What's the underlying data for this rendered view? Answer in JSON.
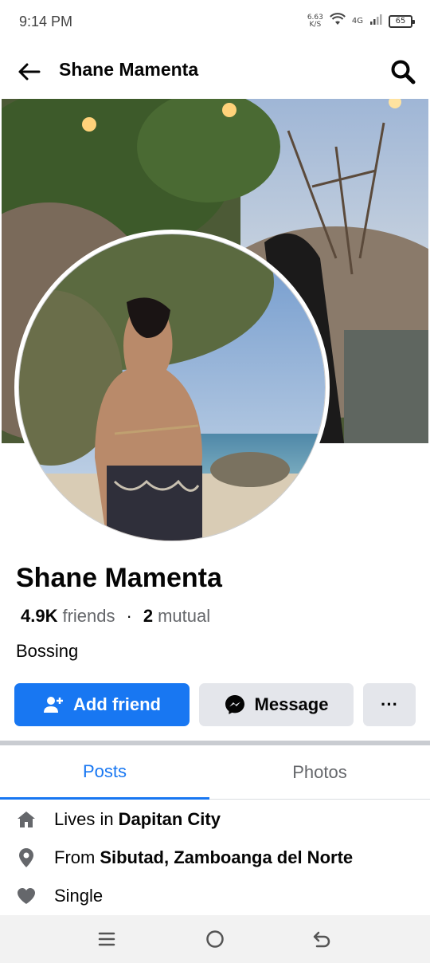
{
  "status_bar": {
    "time": "9:14 PM",
    "net_speed_top": "6.63",
    "net_speed_bottom": "K/S",
    "network": "4G",
    "battery": "65"
  },
  "header": {
    "title": "Shane Mamenta"
  },
  "profile": {
    "name": "Shane Mamenta",
    "friends_count": "4.9K",
    "friends_label": "friends",
    "mutual_count": "2",
    "mutual_label": "mutual",
    "separator": "·",
    "bio": "Bossing"
  },
  "actions": {
    "add_friend": "Add friend",
    "message": "Message",
    "more": "···"
  },
  "tabs": [
    {
      "label": "Posts",
      "active": true
    },
    {
      "label": "Photos",
      "active": false
    }
  ],
  "details": {
    "lives_prefix": "Lives in",
    "lives_value": "Dapitan City",
    "from_prefix": "From",
    "from_value": "Sibutad, Zamboanga del Norte",
    "relationship": "Single"
  },
  "colors": {
    "accent": "#1877f2",
    "button_gray": "#e4e6eb",
    "secondary_text": "#65676b"
  },
  "icons": [
    "back-arrow-icon",
    "search-icon",
    "add-person-icon",
    "messenger-icon",
    "home-icon",
    "location-pin-icon",
    "heart-icon",
    "menu-icon",
    "home-circle-icon",
    "back-nav-icon"
  ]
}
